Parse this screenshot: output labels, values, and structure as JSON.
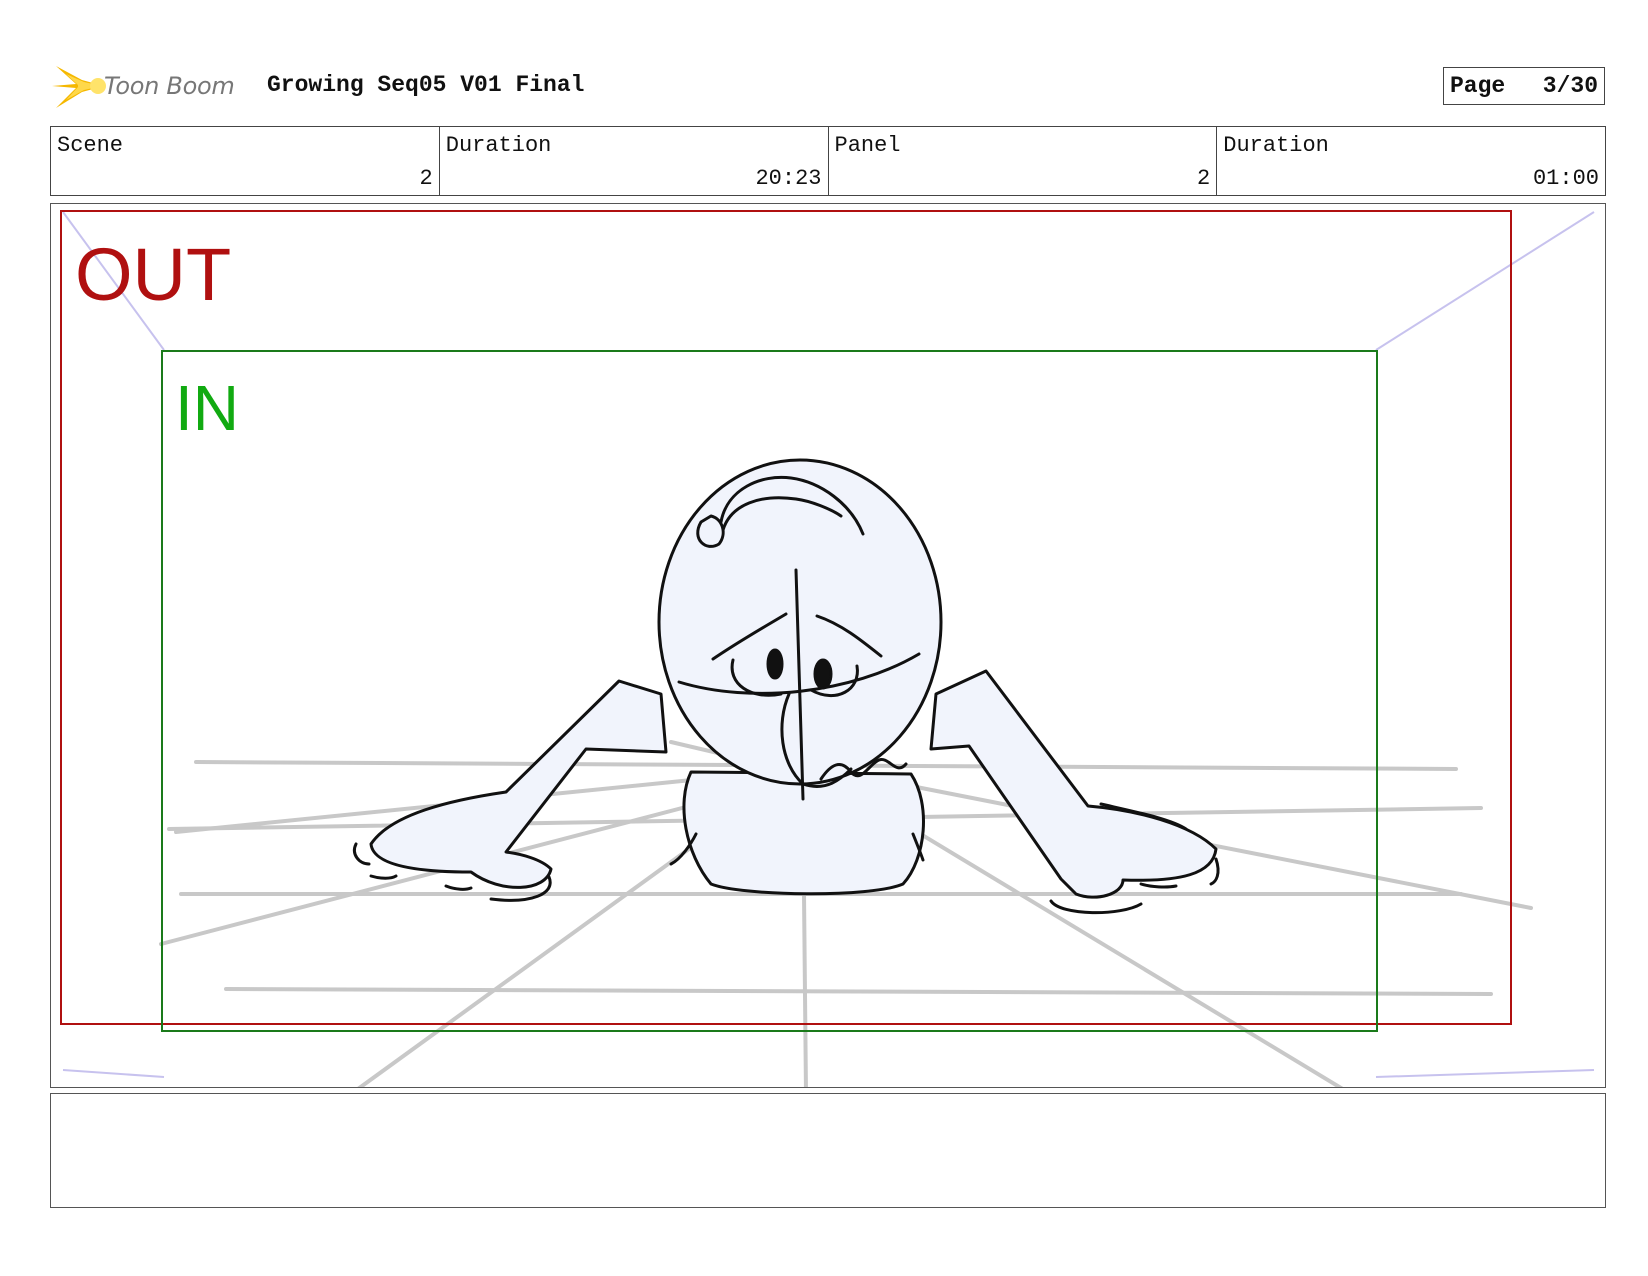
{
  "header": {
    "logo_text": "Toon Boom",
    "title": "Growing Seq05 V01 Final",
    "page_label": "Page",
    "page_value": "3/30"
  },
  "info": [
    {
      "label": "Scene",
      "value": "2"
    },
    {
      "label": "Duration",
      "value": "20:23"
    },
    {
      "label": "Panel",
      "value": "2"
    },
    {
      "label": "Duration",
      "value": "01:00"
    }
  ],
  "panel": {
    "out_label": "OUT",
    "in_label": "IN",
    "colors": {
      "out_frame": "#b01010",
      "in_frame": "#1a7a1a",
      "in_text": "#11aa11",
      "guide": "#c7c2ee",
      "character_fill": "#f1f4fc"
    }
  },
  "notes": {
    "text": ""
  }
}
